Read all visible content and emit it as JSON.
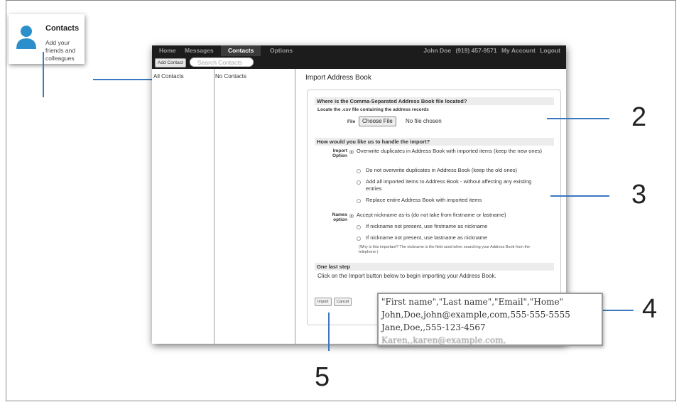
{
  "tile": {
    "title": "Contacts",
    "subtitle": "Add your friends and colleagues",
    "icon": "person-icon",
    "accent": "#2a8fcb"
  },
  "nav": {
    "items": [
      "Home",
      "Messages",
      "Contacts",
      "Options"
    ],
    "active": "Contacts",
    "user": "John Doe",
    "phone": "(919) 457-9571",
    "my_account": "My Account",
    "logout": "Logout"
  },
  "toolbar": {
    "add_contact": "Add Contact",
    "search_placeholder": "Search Contacts"
  },
  "columns": {
    "groups_label": "All Contacts",
    "list_label": "No Contacts"
  },
  "import": {
    "title": "Import Address Book",
    "section_location": "Where is the Comma-Separated Address Book file located?",
    "locate_text": "Locate the .csv file containing the address records",
    "file_label": "File",
    "choose_file": "Choose File",
    "no_file": "No file chosen",
    "section_handle": "How would you like us to handle the import?",
    "import_option_label": "Import Option",
    "import_options": [
      "Overwrite duplicates in Address Book with imported items (keep the new ones)",
      "Do not overwrite duplicates in Address Book (keep the old ones)",
      "Add all imported items to Address Book - without affecting any existing entries",
      "Replace entire Address Book with imported items"
    ],
    "names_option_label": "Names option",
    "names_options": [
      "Accept nickname as-is (do not take from firstname or lastname)",
      "If nickname not present, use firstname as nickname",
      "If nickname not present, use lastname as nickname"
    ],
    "names_note": "(Why is this important? The nickname is the field used when searching your Address Book from the telephone.)",
    "section_last": "One last step",
    "last_text": "Click on the Import button below to begin importing your Address Book.",
    "import_button": "Import",
    "cancel_button": "Cancel"
  },
  "csv_sample": {
    "lines": [
      "\"First name\",\"Last name\",\"Email\",\"Home\"",
      "John,Doe,john@example,com,555-555-5555",
      "Jane,Doe,,555-123-4567",
      "Karen,,karen@example.com,"
    ]
  },
  "callouts": {
    "n2": "2",
    "n3": "3",
    "n4": "4",
    "n5": "5"
  },
  "colors": {
    "callout_line": "#3a78c2",
    "nav_bg": "#1c1c1c"
  }
}
